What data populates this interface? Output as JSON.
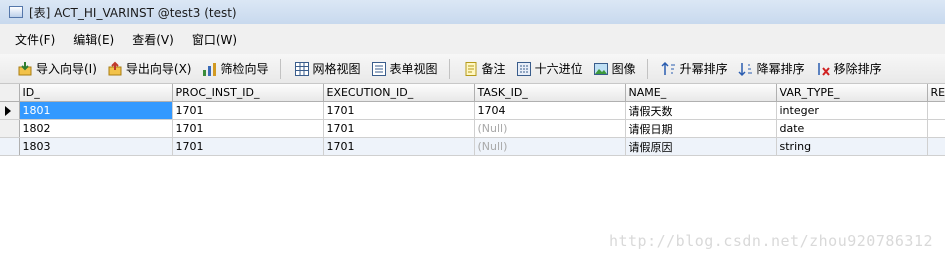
{
  "window": {
    "title": "[表] ACT_HI_VARINST @test3 (test)"
  },
  "menu": [
    "文件(F)",
    "编辑(E)",
    "查看(V)",
    "窗口(W)"
  ],
  "toolbar": {
    "import_wizard": "导入向导(I)",
    "export_wizard": "导出向导(X)",
    "filter_wizard": "筛检向导",
    "grid_view": "网格视图",
    "form_view": "表单视图",
    "memo": "备注",
    "hex": "十六进位",
    "image": "图像",
    "sort_asc": "升幂排序",
    "sort_desc": "降幂排序",
    "remove_sort": "移除排序"
  },
  "table": {
    "columns": [
      "ID_",
      "PROC_INST_ID_",
      "EXECUTION_ID_",
      "TASK_ID_",
      "NAME_",
      "VAR_TYPE_",
      "REV"
    ],
    "rows": [
      [
        "1801",
        "1701",
        "1701",
        "1704",
        "请假天数",
        "integer",
        ""
      ],
      [
        "1802",
        "1701",
        "1701",
        "(Null)",
        "请假日期",
        "date",
        ""
      ],
      [
        "1803",
        "1701",
        "1701",
        "(Null)",
        "请假原因",
        "string",
        ""
      ]
    ]
  },
  "watermark": "http://blog.csdn.net/zhou920786312",
  "colors": {
    "selection": "#3399ff",
    "null_text": "#a9a9a9",
    "title_bar": "#c8d9ee"
  }
}
